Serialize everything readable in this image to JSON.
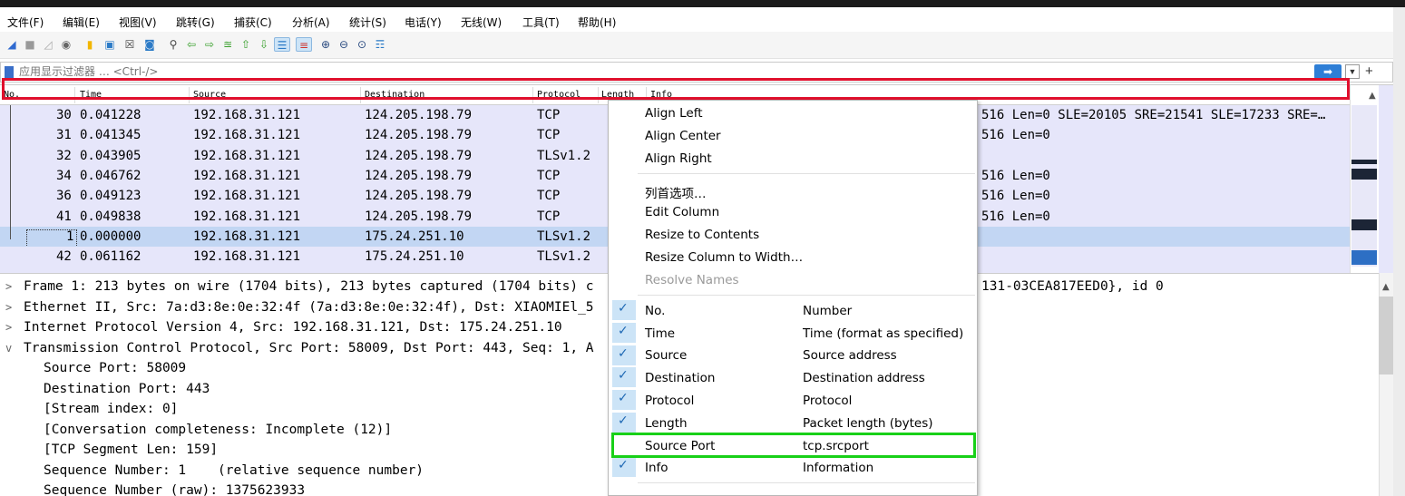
{
  "menubar": [
    "文件(F)",
    "编辑(E)",
    "视图(V)",
    "跳转(G)",
    "捕获(C)",
    "分析(A)",
    "统计(S)",
    "电话(Y)",
    "无线(W)",
    "工具(T)",
    "帮助(H)"
  ],
  "filter": {
    "placeholder": "应用显示过滤器 … <Ctrl-/>",
    "apply_icon": "arrow-right-icon",
    "dropdown_icon": "chevron-down-icon",
    "add_label": "+"
  },
  "columns": [
    "No.",
    "Time",
    "Source",
    "Destination",
    "Protocol",
    "Length",
    "Info"
  ],
  "packets": [
    {
      "no": "30",
      "time": "0.041228",
      "src": "192.168.31.121",
      "dst": "124.205.198.79",
      "proto": "TCP",
      "info": "516 Len=0 SLE=20105 SRE=21541 SLE=17233 SRE=…"
    },
    {
      "no": "31",
      "time": "0.041345",
      "src": "192.168.31.121",
      "dst": "124.205.198.79",
      "proto": "TCP",
      "info": "516 Len=0"
    },
    {
      "no": "32",
      "time": "0.043905",
      "src": "192.168.31.121",
      "dst": "124.205.198.79",
      "proto": "TLSv1.2",
      "info": ""
    },
    {
      "no": "34",
      "time": "0.046762",
      "src": "192.168.31.121",
      "dst": "124.205.198.79",
      "proto": "TCP",
      "info": "516 Len=0"
    },
    {
      "no": "36",
      "time": "0.049123",
      "src": "192.168.31.121",
      "dst": "124.205.198.79",
      "proto": "TCP",
      "info": "516 Len=0"
    },
    {
      "no": "41",
      "time": "0.049838",
      "src": "192.168.31.121",
      "dst": "124.205.198.79",
      "proto": "TCP",
      "info": "516 Len=0"
    },
    {
      "no": "1",
      "time": "0.000000",
      "src": "192.168.31.121",
      "dst": "175.24.251.10",
      "proto": "TLSv1.2",
      "info": ""
    },
    {
      "no": "42",
      "time": "0.061162",
      "src": "192.168.31.121",
      "dst": "175.24.251.10",
      "proto": "TLSv1.2",
      "info": ""
    }
  ],
  "details": [
    {
      "toggle": ">",
      "text": "Frame 1: 213 bytes on wire (1704 bits), 213 bytes captured (1704 bits) c",
      "tail": "131-03CEA817EED0}, id 0"
    },
    {
      "toggle": ">",
      "text": "Ethernet II, Src: 7a:d3:8e:0e:32:4f (7a:d3:8e:0e:32:4f), Dst: XIAOMIEl_5",
      "tail": ""
    },
    {
      "toggle": ">",
      "text": "Internet Protocol Version 4, Src: 192.168.31.121, Dst: 175.24.251.10",
      "tail": ""
    },
    {
      "toggle": "v",
      "text": "Transmission Control Protocol, Src Port: 58009, Dst Port: 443, Seq: 1, A",
      "tail": ""
    },
    {
      "toggle": "",
      "text": "Source Port: 58009",
      "tail": ""
    },
    {
      "toggle": "",
      "text": "Destination Port: 443",
      "tail": ""
    },
    {
      "toggle": "",
      "text": "[Stream index: 0]",
      "tail": ""
    },
    {
      "toggle": "",
      "text": "[Conversation completeness: Incomplete (12)]",
      "tail": ""
    },
    {
      "toggle": "",
      "text": "[TCP Segment Len: 159]",
      "tail": ""
    },
    {
      "toggle": "",
      "text": "Sequence Number: 1    (relative sequence number)",
      "tail": ""
    },
    {
      "toggle": "",
      "text": "Sequence Number (raw): 1375623933",
      "tail": ""
    }
  ],
  "context_menu": {
    "actions": [
      "Align Left",
      "Align Center",
      "Align Right",
      "列首选项…",
      "Edit Column",
      "Resize to Contents",
      "Resize Column to Width…",
      "Resolve Names"
    ],
    "columns": [
      {
        "name": "No.",
        "desc": "Number",
        "checked": true
      },
      {
        "name": "Time",
        "desc": "Time (format as specified)",
        "checked": true
      },
      {
        "name": "Source",
        "desc": "Source address",
        "checked": true
      },
      {
        "name": "Destination",
        "desc": "Destination address",
        "checked": true
      },
      {
        "name": "Protocol",
        "desc": "Protocol",
        "checked": true
      },
      {
        "name": "Length",
        "desc": "Packet length (bytes)",
        "checked": true
      },
      {
        "name": "Source Port",
        "desc": "tcp.srcport",
        "checked": false
      },
      {
        "name": "Info",
        "desc": "Information",
        "checked": true
      }
    ]
  },
  "colors": {
    "highlight_red": "#e0102d",
    "highlight_green": "#18d018",
    "row_tcp": "#e6e6fa",
    "row_selected": "#c2d6f3"
  }
}
